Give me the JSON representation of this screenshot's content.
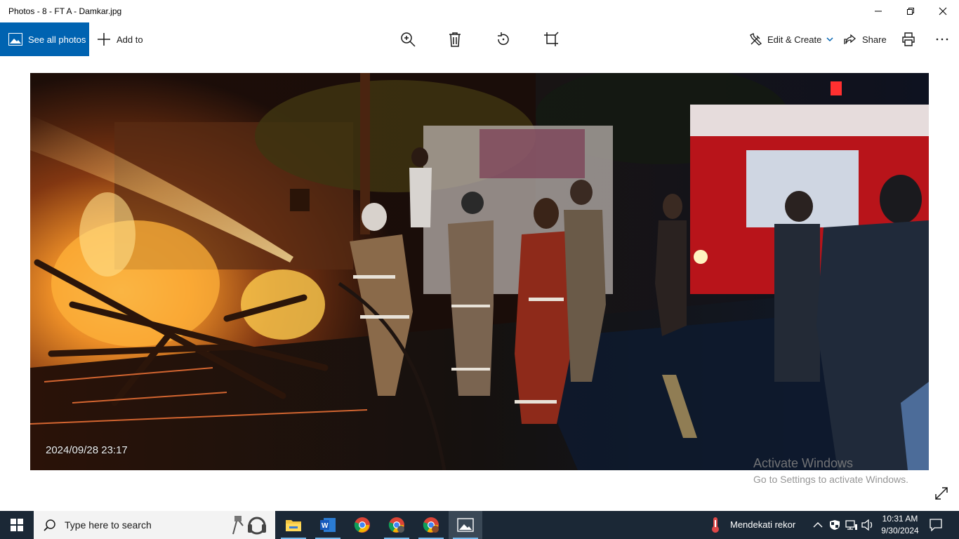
{
  "window": {
    "title": "Photos - 8 - FT A - Damkar.jpg"
  },
  "toolbar": {
    "see_all_label": "See all photos",
    "add_to_label": "Add to",
    "edit_create_label": "Edit & Create",
    "share_label": "Share",
    "more_label": "···",
    "icons": [
      "zoom-icon",
      "delete-icon",
      "rotate-icon",
      "crop-icon",
      "print-icon"
    ]
  },
  "photo": {
    "timestamp": "2024/09/28 23:17"
  },
  "watermark": {
    "line1": "Activate Windows",
    "line2": "Go to Settings to activate Windows."
  },
  "taskbar": {
    "search_placeholder": "Type here to search",
    "weather_text": "Mendekati rekor",
    "time": "10:31 AM",
    "date": "9/30/2024"
  },
  "colors": {
    "accent": "#0063b1",
    "taskbar": "#1b2836"
  }
}
